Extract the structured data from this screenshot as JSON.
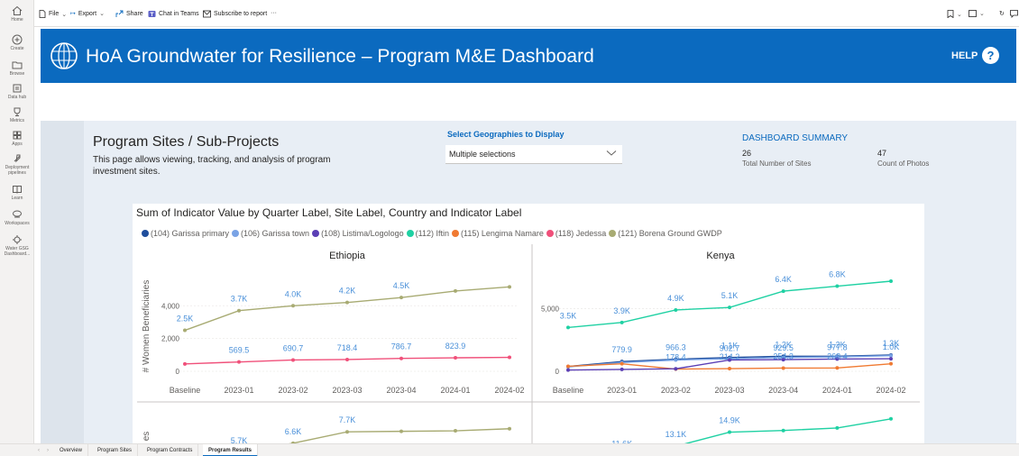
{
  "leftnav": {
    "items": [
      {
        "label": "Home",
        "icon": "home-icon"
      },
      {
        "label": "Create",
        "icon": "plus-circle-icon"
      },
      {
        "label": "Browse",
        "icon": "folder-icon"
      },
      {
        "label": "Data hub",
        "icon": "data-hub-icon"
      },
      {
        "label": "Metrics",
        "icon": "trophy-icon"
      },
      {
        "label": "Apps",
        "icon": "apps-icon"
      },
      {
        "label": "Deployment pipelines",
        "icon": "rocket-icon"
      },
      {
        "label": "Learn",
        "icon": "book-icon"
      },
      {
        "label": "Workspaces",
        "icon": "workspaces-icon"
      },
      {
        "label": "Water GSG Dashboard...",
        "icon": "workspace-badge-icon"
      }
    ]
  },
  "cmdbar": {
    "file": "File",
    "export": "Export",
    "share": "Share",
    "chat": "Chat in Teams",
    "subscribe": "Subscribe to report",
    "more": "···"
  },
  "banner": {
    "title": "HoA Groundwater for Resilience –  Program M&E Dashboard",
    "help": "HELP",
    "help_icon": "?"
  },
  "sites": {
    "title": "Program Sites / Sub-Projects",
    "description": "This page allows viewing, tracking, and analysis of program investment sites."
  },
  "geo": {
    "label": "Select Geographies to Display",
    "value": "Multiple selections"
  },
  "summary": {
    "title": "DASHBOARD SUMMARY",
    "sites_value": "26",
    "sites_label": "Total Number of Sites",
    "photos_value": "47",
    "photos_label": "Count of Photos"
  },
  "chart_data": {
    "type": "line",
    "title": "Sum of Indicator Value by Quarter Label, Site Label, Country and Indicator Label",
    "legend": [
      {
        "name": "(104) Garissa primary",
        "color": "#1f4e9c"
      },
      {
        "name": "(106) Garissa town",
        "color": "#7aa3e5"
      },
      {
        "name": "(108) Listima/Logologo",
        "color": "#5b3fb5"
      },
      {
        "name": "(112) Iftin",
        "color": "#1fd1a3"
      },
      {
        "name": "(115) Lengima Namare",
        "color": "#f07a32"
      },
      {
        "name": "(118) Jedessa",
        "color": "#f0507a"
      },
      {
        "name": "(121) Borena Ground GWDP",
        "color": "#a8ab73"
      }
    ],
    "ylabel": "# Women Beneficiaries",
    "ylabel_second_row": "es",
    "categories": [
      "Baseline",
      "2023-01",
      "2023-02",
      "2023-03",
      "2023-04",
      "2024-01",
      "2024-02"
    ],
    "panels": [
      {
        "title": "Ethiopia",
        "yticks": [
          "4,000",
          "2,000",
          "0"
        ],
        "ylim": [
          0,
          5500
        ],
        "series": [
          {
            "name": "(121) Borena Ground GWDP",
            "color": "#a8ab73",
            "values": [
              2500,
              3700,
              4000,
              4200,
              4500,
              4900,
              5150
            ]
          },
          {
            "name": "(118) Jedessa",
            "color": "#f0507a",
            "values": [
              450,
              569.5,
              690.7,
              718.4,
              786.7,
              823.9,
              850
            ]
          }
        ],
        "labels": [
          {
            "cat": 0,
            "value": 2500,
            "text": "2.5K",
            "color": "#4a90d9"
          },
          {
            "cat": 1,
            "value": 3700,
            "text": "3.7K",
            "color": "#4a90d9"
          },
          {
            "cat": 2,
            "value": 4000,
            "text": "4.0K",
            "color": "#4a90d9"
          },
          {
            "cat": 3,
            "value": 4200,
            "text": "4.2K",
            "color": "#4a90d9"
          },
          {
            "cat": 4,
            "value": 4500,
            "text": "4.5K",
            "color": "#4a90d9"
          },
          {
            "cat": 1,
            "value": 569.5,
            "text": "569.5",
            "color": "#4a90d9"
          },
          {
            "cat": 2,
            "value": 690.7,
            "text": "690.7",
            "color": "#4a90d9"
          },
          {
            "cat": 3,
            "value": 718.4,
            "text": "718.4",
            "color": "#4a90d9"
          },
          {
            "cat": 4,
            "value": 786.7,
            "text": "786.7",
            "color": "#4a90d9"
          },
          {
            "cat": 5,
            "value": 823.9,
            "text": "823.9",
            "color": "#4a90d9"
          }
        ]
      },
      {
        "title": "Kenya",
        "yticks": [
          "5,000",
          "0"
        ],
        "ylim": [
          0,
          7200
        ],
        "series": [
          {
            "name": "(112) Iftin",
            "color": "#1fd1a3",
            "values": [
              3500,
              3900,
              4900,
              5100,
              6400,
              6800,
              7200
            ]
          },
          {
            "name": "(104) Garissa primary",
            "color": "#1f4e9c",
            "values": [
              380,
              779.9,
              966.3,
              1100,
              1200,
              1200,
              1300
            ]
          },
          {
            "name": "(106) Garissa town",
            "color": "#7aa3e5",
            "values": [
              350,
              700,
              900,
              1000,
              1100,
              1150,
              1250
            ]
          },
          {
            "name": "(115) Lengima Namare",
            "color": "#f07a32",
            "values": [
              400,
              600,
              178.4,
              214.2,
              254.3,
              268.4,
              600
            ]
          },
          {
            "name": "(108) Listima/Logologo",
            "color": "#5b3fb5",
            "values": [
              100,
              150,
              200,
              902.7,
              929.5,
              977.8,
              1000
            ]
          }
        ],
        "labels": [
          {
            "cat": 0,
            "value": 3500,
            "text": "3.5K",
            "color": "#4a90d9"
          },
          {
            "cat": 1,
            "value": 3900,
            "text": "3.9K",
            "color": "#4a90d9"
          },
          {
            "cat": 2,
            "value": 4900,
            "text": "4.9K",
            "color": "#4a90d9"
          },
          {
            "cat": 3,
            "value": 5100,
            "text": "5.1K",
            "color": "#4a90d9"
          },
          {
            "cat": 4,
            "value": 6400,
            "text": "6.4K",
            "color": "#4a90d9"
          },
          {
            "cat": 5,
            "value": 6800,
            "text": "6.8K",
            "color": "#4a90d9"
          },
          {
            "cat": 1,
            "value": 779.9,
            "text": "779.9",
            "color": "#4a90d9"
          },
          {
            "cat": 2,
            "value": 966.3,
            "text": "966.3",
            "color": "#4a90d9"
          },
          {
            "cat": 2,
            "value": 178.4,
            "text": "178.4",
            "color": "#4a90d9"
          },
          {
            "cat": 3,
            "value": 1100,
            "text": "1.1K",
            "color": "#4a90d9"
          },
          {
            "cat": 3,
            "value": 214.2,
            "text": "214.2",
            "color": "#4a90d9"
          },
          {
            "cat": 4,
            "value": 1200,
            "text": "1.2K",
            "color": "#4a90d9"
          },
          {
            "cat": 4,
            "value": 254.3,
            "text": "254.3",
            "color": "#4a90d9"
          },
          {
            "cat": 5,
            "value": 1200,
            "text": "1.2K",
            "color": "#4a90d9"
          },
          {
            "cat": 5,
            "value": 268.4,
            "text": "268.4",
            "color": "#4a90d9"
          },
          {
            "cat": 6,
            "value": 1300,
            "text": "1.3K",
            "color": "#4a90d9"
          },
          {
            "cat": 3,
            "value": 902.7,
            "text": "902.7",
            "color": "#4a90d9"
          },
          {
            "cat": 4,
            "value": 929.5,
            "text": "929.5",
            "color": "#4a90d9"
          },
          {
            "cat": 5,
            "value": 977.8,
            "text": "977.8",
            "color": "#4a90d9"
          },
          {
            "cat": 6,
            "value": 1000,
            "text": "1.0K",
            "color": "#4a90d9"
          }
        ]
      }
    ],
    "lower_panels": [
      {
        "series": [
          {
            "name": "(121) Borena Ground GWDP",
            "color": "#a8ab73",
            "values": [
              4900,
              5700,
              6600,
              7700,
              7750,
              7800,
              8000
            ]
          }
        ],
        "labels": [
          {
            "cat": 1,
            "text": "5.7K"
          },
          {
            "cat": 2,
            "text": "6.6K"
          },
          {
            "cat": 3,
            "text": "7.7K"
          }
        ]
      },
      {
        "series": [
          {
            "name": "(112) Iftin",
            "color": "#1fd1a3",
            "values": [
              9800,
              10800,
              11900,
              13600,
              13800,
              14100,
              15200
            ]
          }
        ],
        "labels": [
          {
            "cat": 1,
            "text": "11.6K"
          },
          {
            "cat": 2,
            "text": "13.1K"
          },
          {
            "cat": 3,
            "text": "14.9K"
          }
        ]
      }
    ]
  },
  "tabs": {
    "items": [
      "Overview",
      "Program Sites",
      "Program Contracts",
      "Program Results"
    ],
    "active": "Program Results"
  },
  "colors": {
    "brand": "#0b6abf",
    "canvas": "#e8eef5"
  }
}
